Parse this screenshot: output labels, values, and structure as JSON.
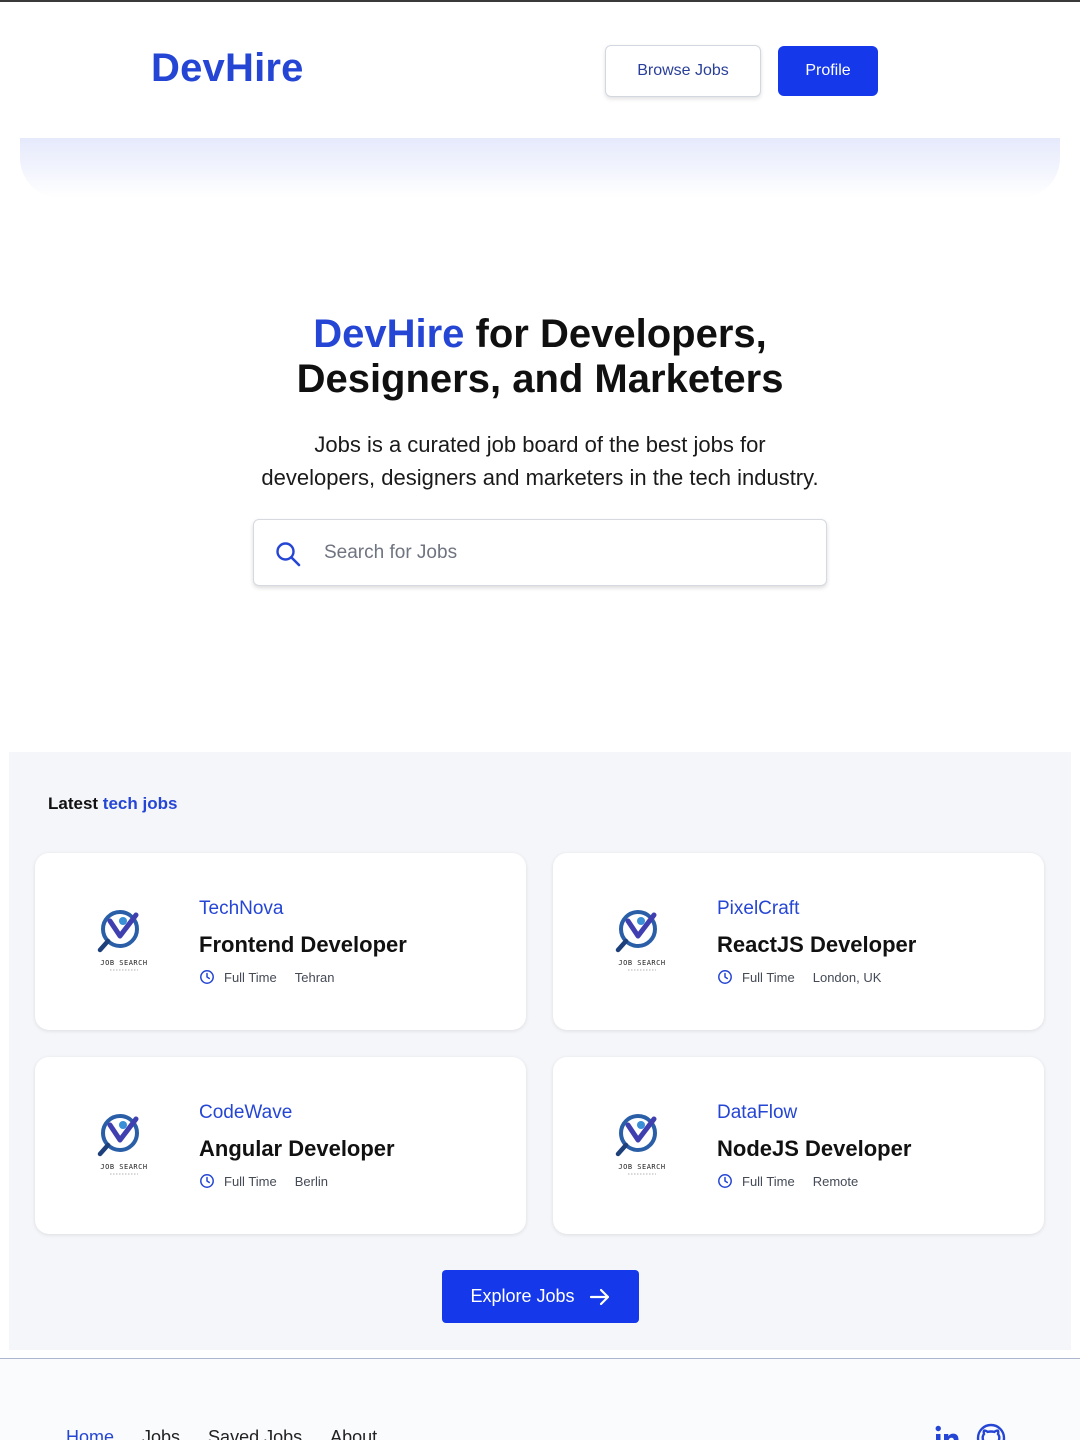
{
  "header": {
    "brand": "DevHire",
    "browse_label": "Browse Jobs",
    "profile_label": "Profile"
  },
  "hero": {
    "title_accent": "DevHire",
    "title_rest_line1": " for Developers,",
    "title_line2": "Designers, and Marketers",
    "subtitle_line1": "Jobs is a curated job board of the best jobs for",
    "subtitle_line2": "developers, designers and marketers in the tech industry.",
    "search_placeholder": "Search for Jobs",
    "search_value": ""
  },
  "jobs": {
    "heading_plain": "Latest ",
    "heading_accent": "tech jobs",
    "logo_text": "JOB SEARCH",
    "items": [
      {
        "company": "TechNova",
        "role": "Frontend Developer",
        "type": "Full Time",
        "location": "Tehran"
      },
      {
        "company": "PixelCraft",
        "role": "ReactJS Developer",
        "type": "Full Time",
        "location": "London, UK"
      },
      {
        "company": "CodeWave",
        "role": "Angular Developer",
        "type": "Full Time",
        "location": "Berlin"
      },
      {
        "company": "DataFlow",
        "role": "NodeJS Developer",
        "type": "Full Time",
        "location": "Remote"
      }
    ],
    "explore_label": "Explore Jobs"
  },
  "footer": {
    "nav": [
      "Home",
      "Jobs",
      "Saved Jobs",
      "About"
    ],
    "social_icons": [
      "linkedin-icon",
      "github-icon"
    ]
  },
  "colors": {
    "brand": "#2546d4",
    "primary_button": "#1438ea",
    "section_bg": "#f5f6fa"
  }
}
